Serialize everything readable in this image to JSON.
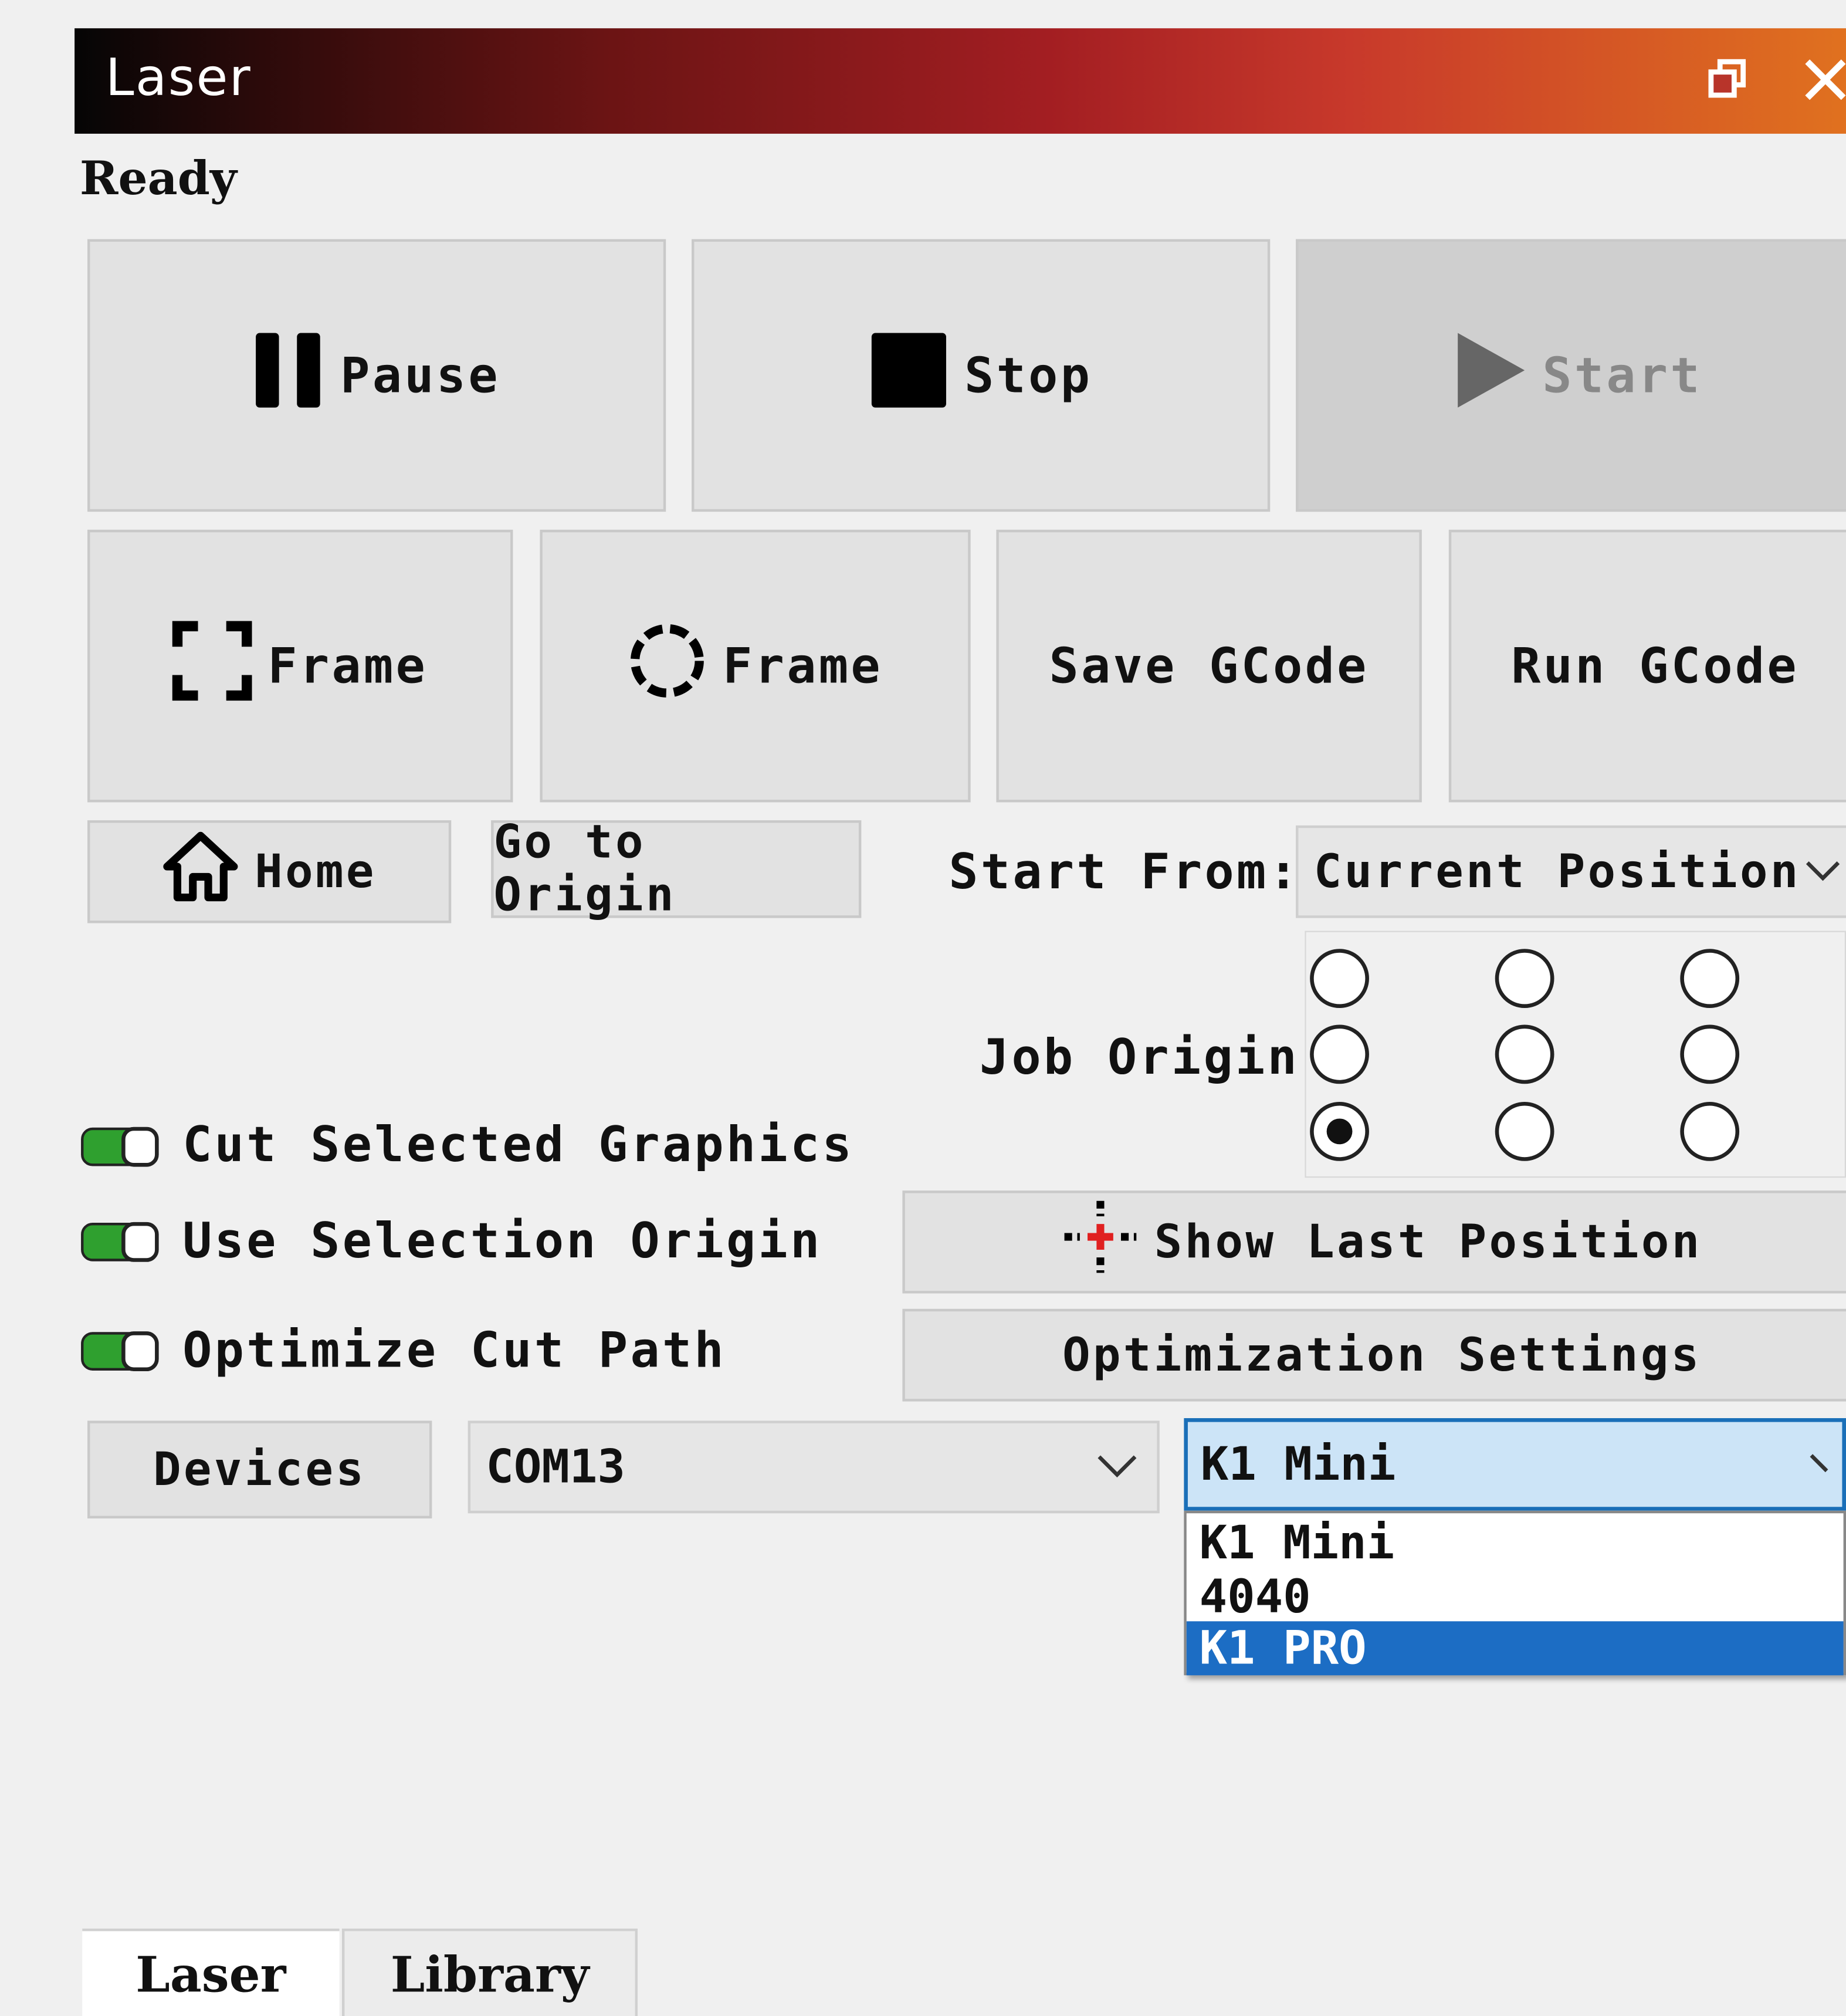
{
  "window": {
    "title": "Laser",
    "restore_icon": "restore-window-icon",
    "close_icon": "close-icon",
    "title_gradient": [
      "#050505",
      "#a31e22",
      "#e0711f"
    ]
  },
  "status": "Ready",
  "controls": {
    "pause_label": "Pause",
    "stop_label": "Stop",
    "start_label": "Start",
    "frame_rect_label": "Frame",
    "frame_circle_label": "Frame",
    "save_gcode_label": "Save GCode",
    "run_gcode_label": "Run GCode",
    "home_label": "Home",
    "go_to_origin_label": "Go to Origin"
  },
  "start_from": {
    "label": "Start From:",
    "value": "Current Position"
  },
  "job_origin": {
    "label": "Job Origin",
    "selected_index": 6
  },
  "options": {
    "cut_selected_graphics": "Cut Selected Graphics",
    "use_selection_origin": "Use Selection Origin",
    "optimize_cut_path": "Optimize Cut Path",
    "toggle_color": "#2fa02f"
  },
  "buttons": {
    "show_last_position": "Show Last Position",
    "optimization_settings": "Optimization Settings",
    "devices": "Devices"
  },
  "port": {
    "value": "COM13"
  },
  "model": {
    "value": "K1 Mini",
    "options": [
      "K1 Mini",
      "4040",
      "K1 PRO"
    ],
    "highlighted": "K1 PRO"
  },
  "tabs": [
    "Laser",
    "Library"
  ]
}
